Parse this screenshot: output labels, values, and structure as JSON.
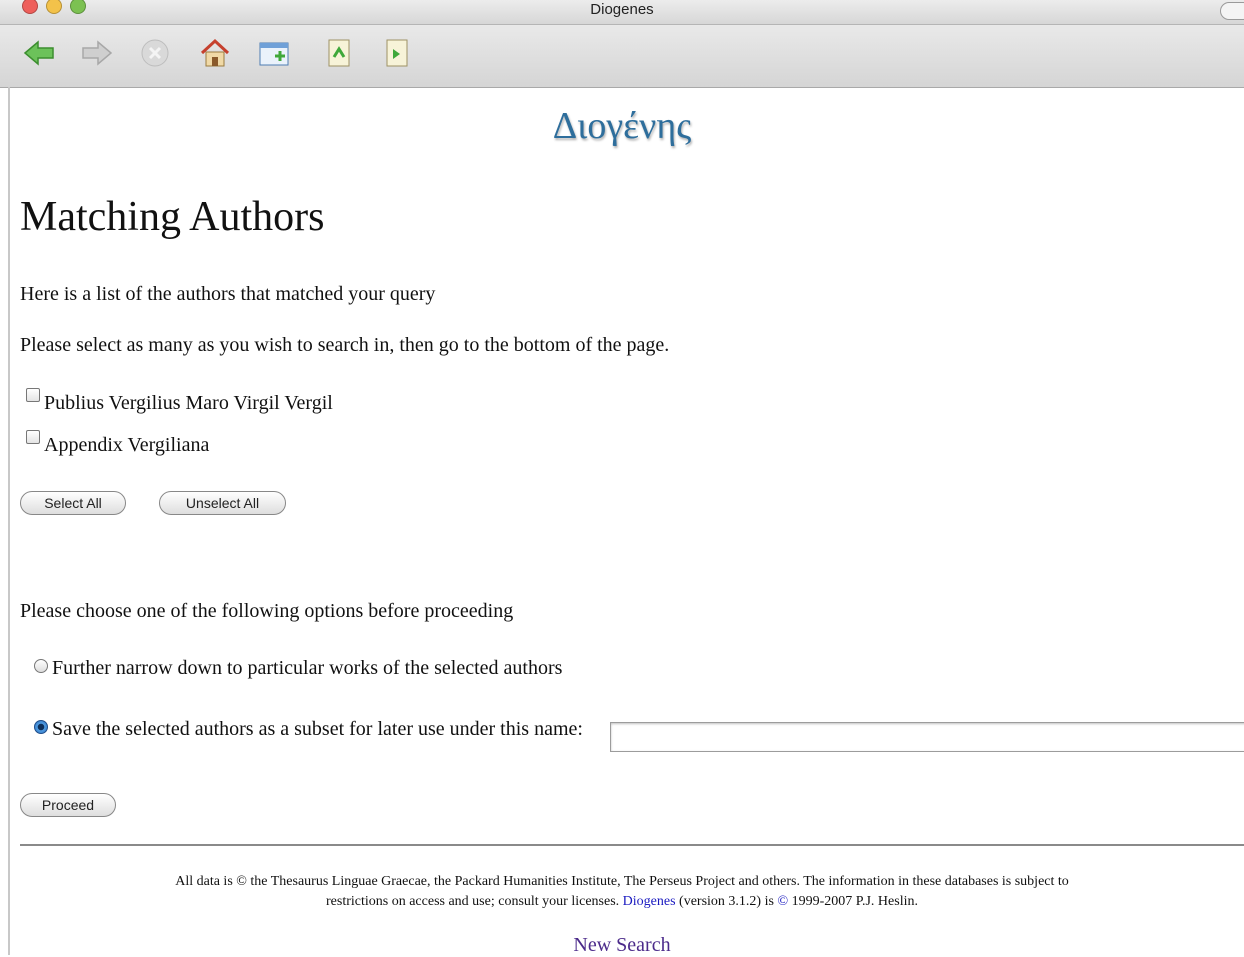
{
  "window": {
    "title": "Diogenes"
  },
  "toolbar": {
    "icons": [
      "back-icon",
      "forward-icon",
      "stop-icon",
      "home-icon",
      "new-window-icon",
      "print-icon",
      "save-icon"
    ]
  },
  "logo": {
    "text": "Διογένης"
  },
  "page": {
    "heading": "Matching Authors",
    "intro": "Here is a list of the authors that matched your query",
    "instruction": "Please select as many as you wish to search in, then go to the bottom of the page."
  },
  "authors": [
    {
      "label": "Publius Vergilius Maro Virgil Vergil",
      "checked": false
    },
    {
      "label": "Appendix Vergiliana",
      "checked": false
    }
  ],
  "buttons": {
    "select_all": "Select All",
    "unselect_all": "Unselect All",
    "proceed": "Proceed"
  },
  "options": {
    "prompt": "Please choose one of the following options before proceeding",
    "narrow": "Further narrow down to particular works of the selected authors",
    "save_subset": "Save the selected authors as a subset for later use under this name:",
    "selected": "save_subset",
    "subset_name_value": ""
  },
  "footer": {
    "line1": "All data is © the Thesaurus Linguae Graecae, the Packard Humanities Institute, The Perseus Project and others. The information in these databases is subject to",
    "line2_pre": "restrictions on access and use; consult your licenses.",
    "line2_link": "Diogenes",
    "line2_mid": "(version 3.1.2) is",
    "line2_copy": "©",
    "line2_post": "1999-2007 P.J. Heslin."
  },
  "new_search": "New Search"
}
